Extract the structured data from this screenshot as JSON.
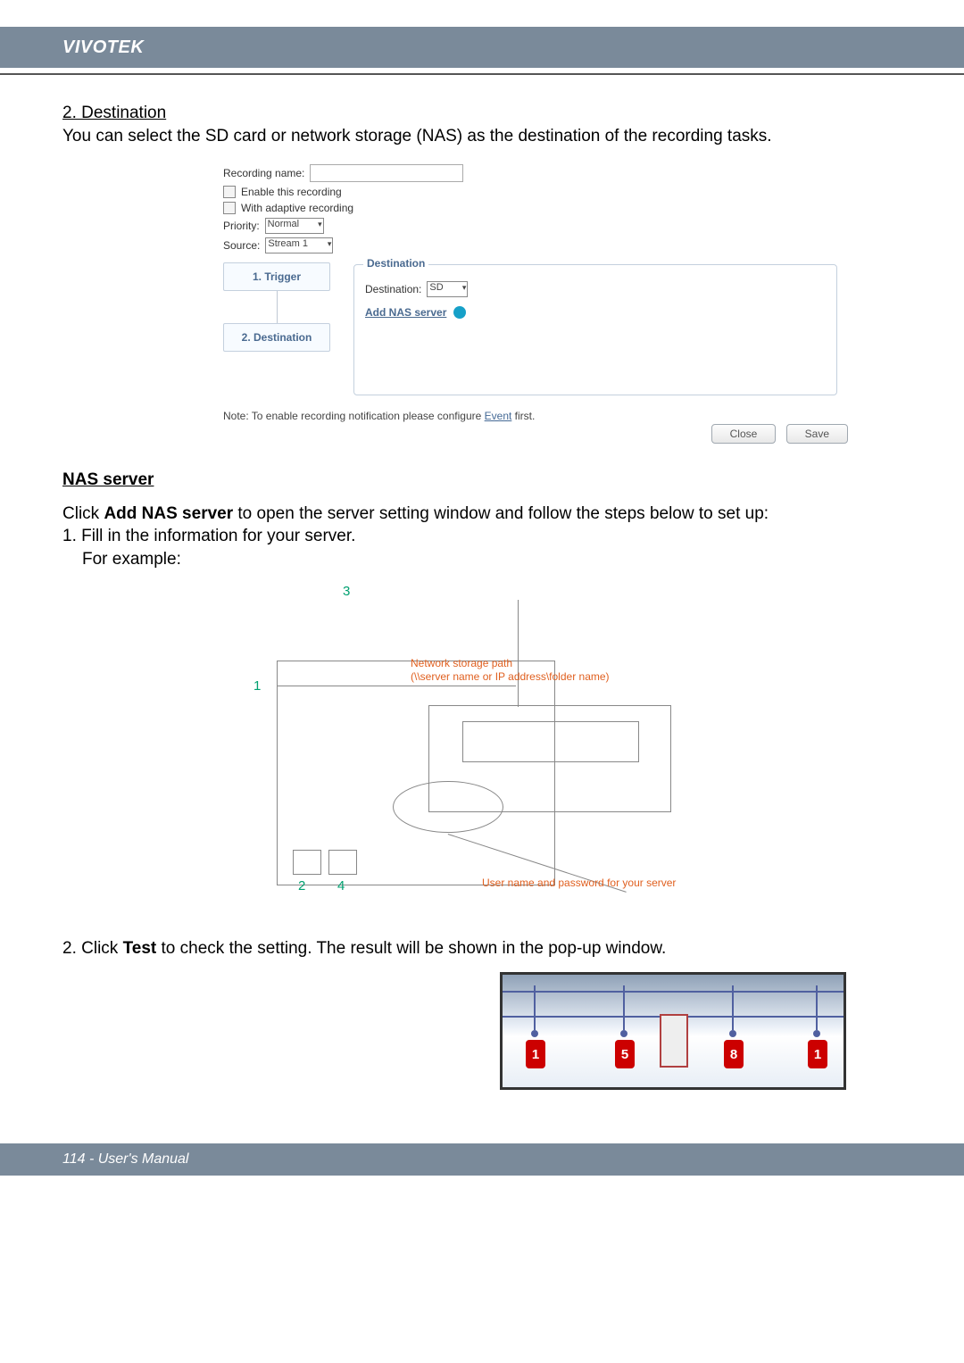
{
  "brand": "VIVOTEK",
  "section": {
    "title": "2. Destination",
    "intro": "You can select the SD card or network storage (NAS) as the destination of the recording tasks."
  },
  "form": {
    "recording_name_label": "Recording name:",
    "enable_label": "Enable this recording",
    "adaptive_label": "With adaptive recording",
    "priority_label": "Priority:",
    "priority_value": "Normal",
    "source_label": "Source:",
    "source_value": "Stream 1"
  },
  "wizard": {
    "step1": "1.  Trigger",
    "step2": "2.  Destination",
    "dest_legend": "Destination",
    "dest_label": "Destination:",
    "dest_value": "SD",
    "add_nas": "Add NAS server"
  },
  "note_prefix": "Note: To enable recording notification please configure ",
  "note_link": "Event",
  "note_suffix": " first.",
  "buttons": {
    "close": "Close",
    "save": "Save"
  },
  "nas": {
    "heading": "NAS server",
    "intro_1": "Click ",
    "intro_bold": "Add NAS server",
    "intro_2": " to open the server setting window and follow the steps below to set up:",
    "step1": "1. Fill in the information for your server.",
    "example": "For example:",
    "callouts": {
      "n1": "1",
      "n2": "2",
      "n3": "3",
      "n4": "4",
      "path_label1": "Network storage path",
      "path_label2": "(\\\\server name or IP address\\folder name)",
      "creds_label": "User name and password for your server"
    },
    "step2_a": "2. Click ",
    "step2_b": "Test",
    "step2_c": " to check the setting. The result will be shown in the pop-up window."
  },
  "lan_cams": [
    "1",
    "5",
    "8",
    "1"
  ],
  "footer": "114 - User's Manual"
}
